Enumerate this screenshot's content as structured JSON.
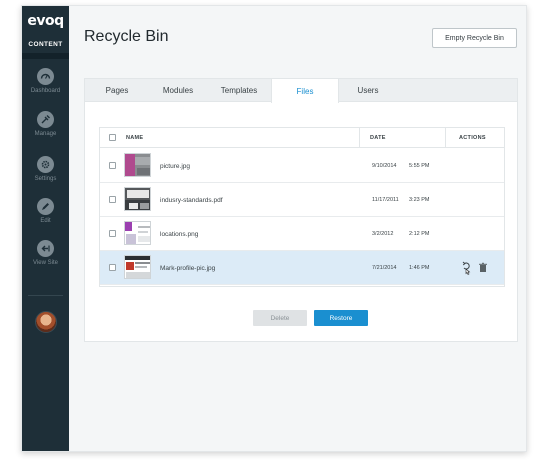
{
  "brand": {
    "logo": "evoq",
    "subtitle": "CONTENT"
  },
  "sidebar": {
    "items": [
      {
        "label": "Dashboard",
        "icon": "dashboard-icon"
      },
      {
        "label": "Manage",
        "icon": "manage-icon"
      },
      {
        "label": "Settings",
        "icon": "gear-icon"
      },
      {
        "label": "Edit",
        "icon": "pencil-icon"
      },
      {
        "label": "View Site",
        "icon": "view-site-icon"
      }
    ]
  },
  "header": {
    "title": "Recycle Bin",
    "empty_button": "Empty Recycle Bin"
  },
  "tabs": [
    {
      "label": "Pages"
    },
    {
      "label": "Modules"
    },
    {
      "label": "Templates"
    },
    {
      "label": "Files",
      "active": true
    },
    {
      "label": "Users"
    }
  ],
  "table": {
    "columns": {
      "name": "NAME",
      "date": "DATE",
      "actions": "ACTIONS"
    },
    "rows": [
      {
        "name": "picture.jpg",
        "date": "9/10/2014",
        "time": "5:55 PM",
        "selected": false
      },
      {
        "name": "indusry-standards.pdf",
        "date": "11/17/2011",
        "time": "3:23 PM",
        "selected": false
      },
      {
        "name": "locations.png",
        "date": "3/2/2012",
        "time": "2:12 PM",
        "selected": false
      },
      {
        "name": "Mark-profile-pic.jpg",
        "date": "7/21/2014",
        "time": "1:46 PM",
        "selected": true
      }
    ]
  },
  "buttons": {
    "delete": "Delete",
    "restore": "Restore"
  },
  "colors": {
    "accent": "#1a8fd0",
    "sidebar": "#1e2f38",
    "selected_row": "#dcebf7"
  }
}
